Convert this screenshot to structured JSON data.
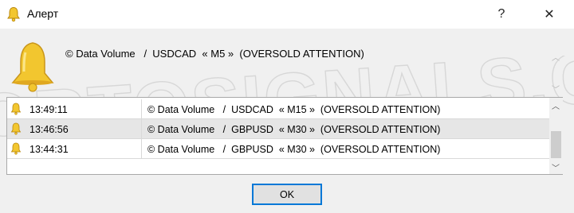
{
  "window": {
    "title": "Алерт",
    "help_label": "?",
    "close_label": "✕"
  },
  "top_message": {
    "text": "© Data Volume   /  USDCAD  « M5 »  (OVERSOLD ATTENTION)"
  },
  "watermark": {
    "text": "VIKORTOSIGNALS.COM"
  },
  "alerts": [
    {
      "time": "13:49:11",
      "message": "© Data Volume   /  USDCAD  « M15 »  (OVERSOLD ATTENTION)"
    },
    {
      "time": "13:46:56",
      "message": "© Data Volume   /  GBPUSD  « M30 »  (OVERSOLD ATTENTION)"
    },
    {
      "time": "13:44:31",
      "message": "© Data Volume   /  GBPUSD  « M30 »  (OVERSOLD ATTENTION)"
    }
  ],
  "buttons": {
    "ok_label": "OK"
  },
  "icons": {
    "title": "bell-icon",
    "large": "bell-icon",
    "row": "bell-icon"
  },
  "colors": {
    "bell": "#f2c62f",
    "focus_border": "#0078d7",
    "selected_row": "#e6e6e6"
  }
}
